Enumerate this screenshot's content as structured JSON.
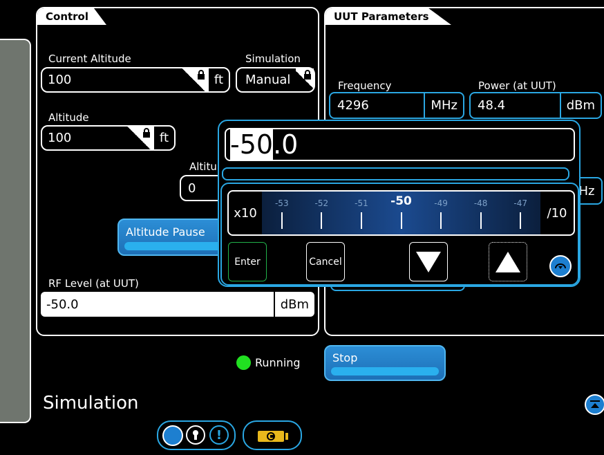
{
  "control": {
    "tab_label": "Control",
    "current_altitude": {
      "label": "Current Altitude",
      "value": "100",
      "unit": "ft"
    },
    "simulation": {
      "label": "Simulation",
      "value": "Manual"
    },
    "altitude": {
      "label": "Altitude",
      "value": "100",
      "unit": "ft"
    },
    "altitude_rate": {
      "label": "Altitu",
      "value": "0"
    },
    "altitude_pause": {
      "label": "Altitude Pause"
    },
    "rf_level": {
      "label": "RF Level (at UUT)",
      "value": "-50.0",
      "unit": "dBm"
    }
  },
  "uut": {
    "tab_label": "UUT Parameters",
    "frequency": {
      "label": "Frequency",
      "value": "4296",
      "unit": "MHz"
    },
    "power": {
      "label": "Power (at UUT)",
      "value": "48.4",
      "unit": "dBm"
    },
    "hidden_unit": "Hz"
  },
  "popup": {
    "entry_selected": "-50",
    "entry_rest": ".0",
    "scale_left": "x10",
    "scale_right": "/10",
    "ticks": [
      "-53",
      "-52",
      "-51",
      "-50",
      "-49",
      "-48",
      "-47"
    ],
    "enter_label": "Enter",
    "cancel_label": "Cancel"
  },
  "status": {
    "text": "Running",
    "color": "#21e021"
  },
  "stop_label": "Stop",
  "footer": {
    "title": "Simulation"
  },
  "colors": {
    "accent": "#2aa7e3",
    "side_tab": "#6f756e",
    "battery": "#e8b81c"
  }
}
